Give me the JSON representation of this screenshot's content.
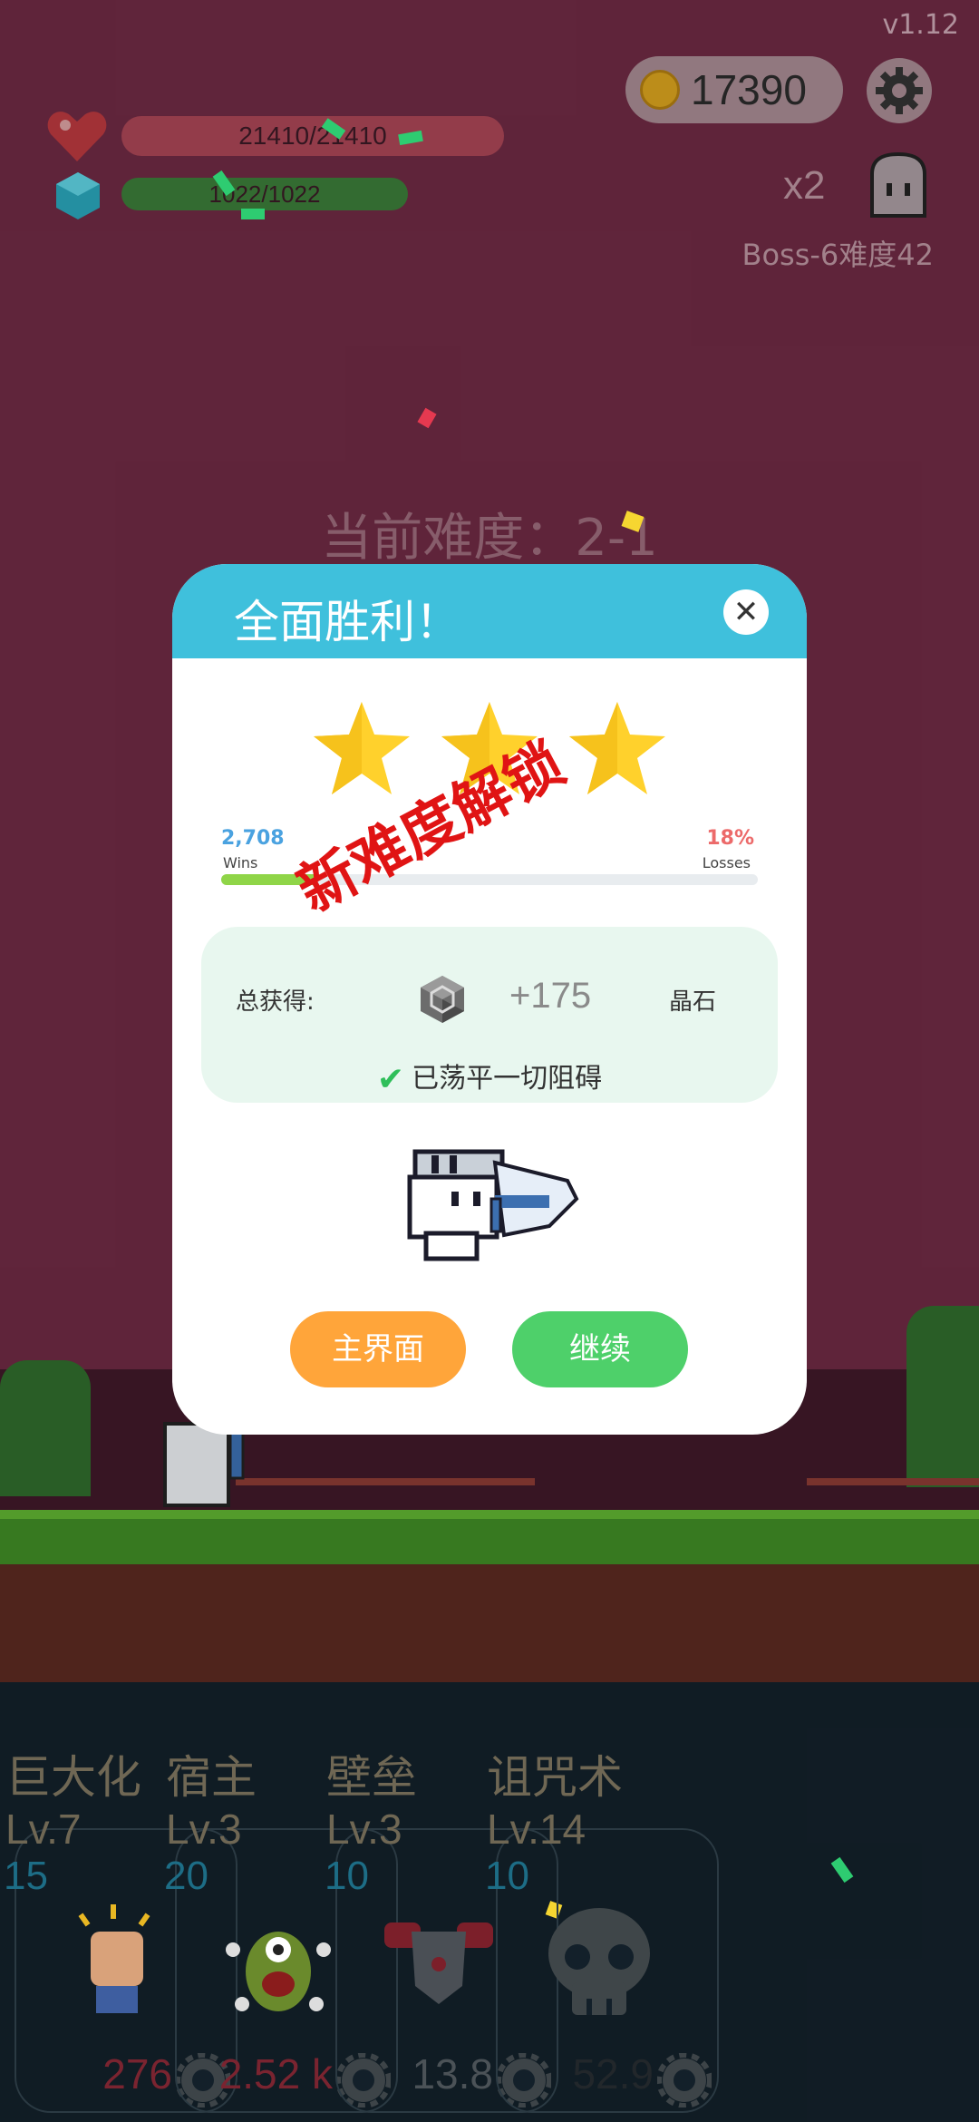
{
  "version": "v1.12",
  "coins": "17390",
  "hp": "21410/21410",
  "mp": "1022/1022",
  "multiplier": "x2",
  "boss_label": "Boss-6难度42",
  "current_difficulty": "当前难度：2-1",
  "dialog": {
    "title": "全面胜利！",
    "stars": 3,
    "wins_value": "2,708",
    "wins_label": "Wins",
    "losses_value": "18%",
    "losses_label": "Losses",
    "win_fraction": 0.18,
    "stamp": "新难度解锁",
    "reward_label": "总获得:",
    "reward_value": "+175",
    "reward_unit": "晶石",
    "clear_text": "已荡平一切阻碍",
    "home_button": "主界面",
    "continue_button": "继续"
  },
  "skills": [
    {
      "name": "巨大化",
      "level": "Lv.7",
      "cost": "15",
      "value": "276",
      "value_color": "#7a2430",
      "icon": "fist-icon"
    },
    {
      "name": "宿主",
      "level": "Lv.3",
      "cost": "20",
      "value": "2.52 k",
      "value_color": "#7a2430",
      "icon": "monster-icon"
    },
    {
      "name": "壁垒",
      "level": "Lv.3",
      "cost": "10",
      "value": "13.8",
      "value_color": "#4b5257",
      "icon": "armor-icon"
    },
    {
      "name": "诅咒术",
      "level": "Lv.14",
      "cost": "10",
      "value": "52.9",
      "value_color": "#22272b",
      "icon": "skull-icon"
    }
  ],
  "colors": {
    "header": "#3fc0dc",
    "home_button": "#ffa53a",
    "continue_button": "#4ed06a",
    "stamp": "#e01414"
  }
}
